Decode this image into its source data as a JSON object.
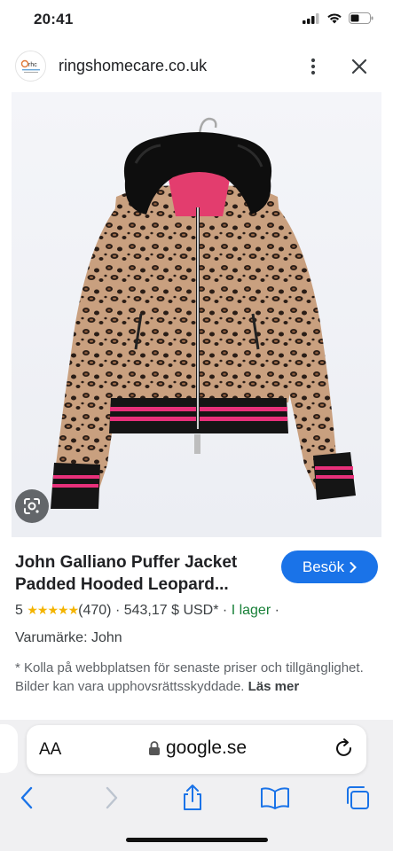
{
  "status_bar": {
    "time": "20:41"
  },
  "site": {
    "domain": "ringshomecare.co.uk",
    "logo_text": "rhc"
  },
  "product": {
    "title": "John Galliano Puffer Jacket Padded Hooded Leopard...",
    "visit_label": "Besök",
    "rating_value": "5",
    "stars": "★★★★★",
    "review_count": "(470)",
    "price": "543,17 $ USD*",
    "availability": "I lager",
    "brand": "Varumärke: John",
    "disclaimer": "* Kolla på webbplatsen för senaste priser och tillgänglighet. Bilder kan vara upphovsrättsskyddade.",
    "read_more": "Läs mer"
  },
  "browser": {
    "aa_label": "AA",
    "url": "google.se"
  },
  "colors": {
    "accent": "#1a73e8",
    "stock": "#188038",
    "stars": "#f4b400"
  }
}
